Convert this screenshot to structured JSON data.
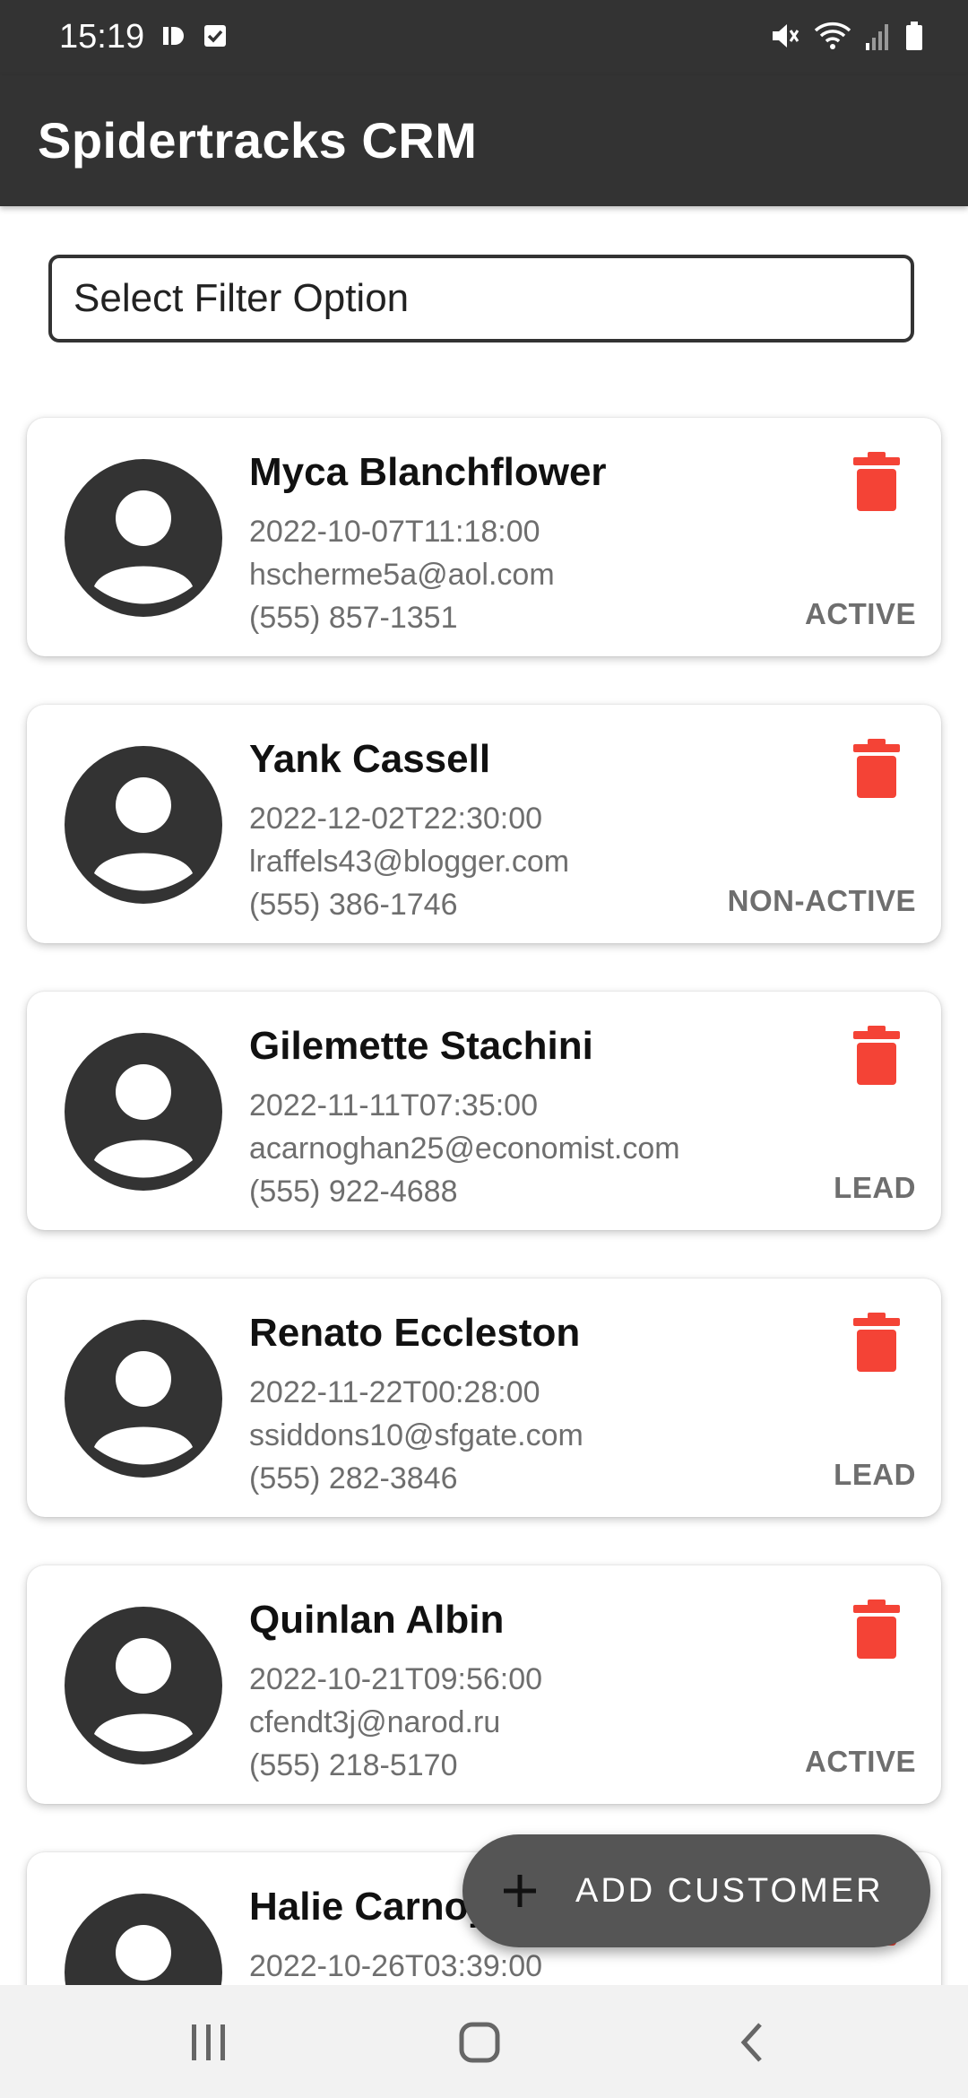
{
  "status_bar": {
    "time": "15:19",
    "icons": [
      "notification-d-icon",
      "checkbox-icon",
      "mute-icon",
      "wifi-icon",
      "signal-icon",
      "battery-icon"
    ]
  },
  "app_bar": {
    "title": "Spidertracks CRM"
  },
  "filter": {
    "placeholder": "Select Filter Option"
  },
  "customers": [
    {
      "name": "Myca Blanchflower",
      "date": "2022-10-07T11:18:00",
      "email": "hscherme5a@aol.com",
      "phone": "(555) 857-1351",
      "status": "ACTIVE"
    },
    {
      "name": "Yank Cassell",
      "date": "2022-12-02T22:30:00",
      "email": "lraffels43@blogger.com",
      "phone": "(555) 386-1746",
      "status": "NON-ACTIVE"
    },
    {
      "name": "Gilemette Stachini",
      "date": "2022-11-11T07:35:00",
      "email": "acarnoghan25@economist.com",
      "phone": "(555) 922-4688",
      "status": "LEAD"
    },
    {
      "name": "Renato Eccleston",
      "date": "2022-11-22T00:28:00",
      "email": "ssiddons10@sfgate.com",
      "phone": "(555) 282-3846",
      "status": "LEAD"
    },
    {
      "name": "Quinlan Albin",
      "date": "2022-10-21T09:56:00",
      "email": "cfendt3j@narod.ru",
      "phone": "(555) 218-5170",
      "status": "ACTIVE"
    },
    {
      "name": "Halie Carnoy",
      "date": "2022-10-26T03:39:00",
      "email": "",
      "phone": "",
      "status": ""
    }
  ],
  "fab": {
    "label": "ADD CUSTOMER",
    "icon": "plus-icon"
  },
  "nav_bar": {
    "icons": [
      "recent-apps-icon",
      "home-icon",
      "back-icon"
    ]
  },
  "colors": {
    "header": "#333333",
    "delete": "#f44336",
    "fab": "#555555",
    "muted_text": "#6e6e6e"
  }
}
